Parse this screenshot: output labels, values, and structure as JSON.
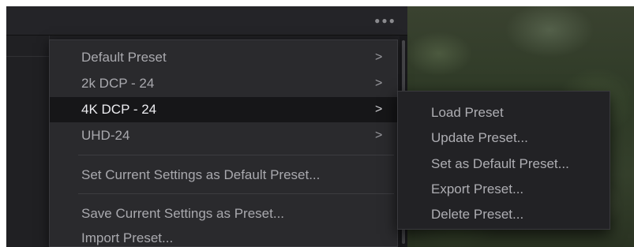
{
  "topbar": {
    "options_icon": "ellipsis-icon",
    "options_glyph": "●●●"
  },
  "menu": {
    "items": [
      {
        "label": "Default Preset",
        "has_submenu": true,
        "arrow": ">"
      },
      {
        "label": "2k DCP - 24",
        "has_submenu": true,
        "arrow": ">"
      },
      {
        "label": "4K DCP - 24",
        "has_submenu": true,
        "arrow": ">",
        "active": true
      },
      {
        "label": "UHD-24",
        "has_submenu": true,
        "arrow": ">"
      },
      {
        "label": "Set Current Settings as Default Preset..."
      },
      {
        "label": "Save Current Settings as Preset..."
      },
      {
        "label": "Import Preset..."
      }
    ]
  },
  "submenu": {
    "items": [
      {
        "label": "Load Preset"
      },
      {
        "label": "Update Preset..."
      },
      {
        "label": "Set as Default Preset..."
      },
      {
        "label": "Export Preset..."
      },
      {
        "label": "Delete Preset..."
      }
    ]
  },
  "colors": {
    "menu_bg": "#2a2a2d",
    "active_bg": "#161618",
    "text": "#a9a9ae",
    "active_text": "#ececf0"
  }
}
